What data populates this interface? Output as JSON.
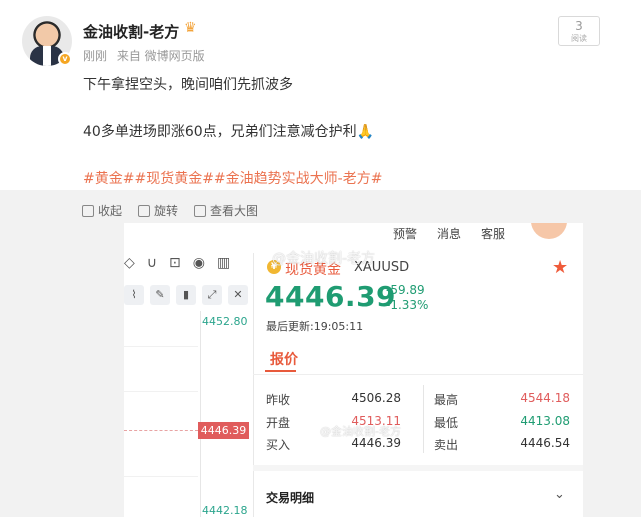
{
  "post": {
    "author": "金油收割-老方",
    "time": "刚刚",
    "source": "来自 微博网页版",
    "read_count": "3",
    "read_label": "阅读",
    "line1": "下午拿捏空头，晚间咱们先抓波多",
    "line2": "40多单进场即涨60点，兄弟们注意减仓护利🙏",
    "hashtags": "#黄金##现货黄金##金油趋势实战大师-老方#"
  },
  "actions": {
    "collapse": "收起",
    "rotate": "旋转",
    "view_large": "查看大图"
  },
  "app": {
    "topbar": [
      "预警",
      "消息",
      "客服"
    ],
    "watermark": "@金油收割-老方",
    "instrument_name": "现货黄金",
    "symbol": "XAUUSD",
    "price": "4446.39",
    "change": "-59.89",
    "change_pct": "-1.33%",
    "updated": "最后更新:19:05:11",
    "tab": "报价",
    "chart_labels": {
      "top": "4452.80",
      "current": "4446.39",
      "bottom": "4442.18"
    },
    "quotes": {
      "prev_close_label": "昨收",
      "prev_close": "4506.28",
      "high_label": "最高",
      "high": "4544.18",
      "open_label": "开盘",
      "open": "4513.11",
      "low_label": "最低",
      "low": "4413.08",
      "buy_label": "买入",
      "buy": "4446.39",
      "sell_label": "卖出",
      "sell": "4446.54"
    },
    "trade_detail": "交易明细",
    "colors": {
      "up": "#1f9c72",
      "down": "#e05c5c",
      "accent": "#e85a3c"
    }
  }
}
